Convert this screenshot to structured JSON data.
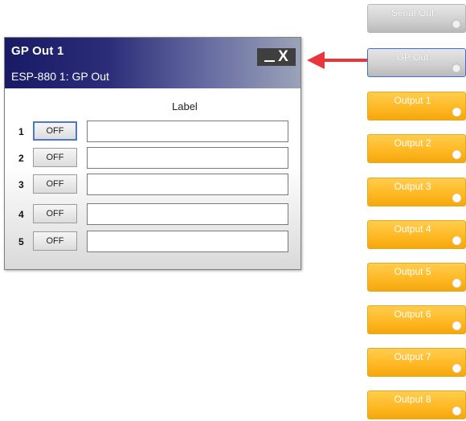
{
  "dialog": {
    "title": "GP Out 1",
    "subtitle": "ESP-880 1: GP Out",
    "minimize_icon": "minimize-icon",
    "close_icon": "close-icon",
    "close_glyph": "X",
    "label_header": "Label",
    "rows": [
      {
        "number": "1",
        "button": "OFF",
        "label_value": "",
        "focused": true
      },
      {
        "number": "2",
        "button": "OFF",
        "label_value": "",
        "focused": false
      },
      {
        "number": "3",
        "button": "OFF",
        "label_value": "",
        "focused": false
      },
      {
        "number": "4",
        "button": "OFF",
        "label_value": "",
        "focused": false
      },
      {
        "number": "5",
        "button": "OFF",
        "label_value": "",
        "focused": false
      }
    ]
  },
  "blocks": [
    {
      "label": "Serial Out",
      "style": "gray"
    },
    {
      "label": "GP Out",
      "style": "gray-selected"
    },
    {
      "label": "Output 1",
      "style": "orange"
    },
    {
      "label": "Output 2",
      "style": "orange"
    },
    {
      "label": "Output 3",
      "style": "orange"
    },
    {
      "label": "Output 4",
      "style": "orange"
    },
    {
      "label": "Output 5",
      "style": "orange"
    },
    {
      "label": "Output 6",
      "style": "orange"
    },
    {
      "label": "Output 7",
      "style": "orange"
    },
    {
      "label": "Output 8",
      "style": "orange"
    }
  ],
  "colors": {
    "titlebar_dark": "#191a66",
    "output_block": "#ffb924",
    "arrow": "#e8363c",
    "selected_border": "#3c6fd0"
  }
}
